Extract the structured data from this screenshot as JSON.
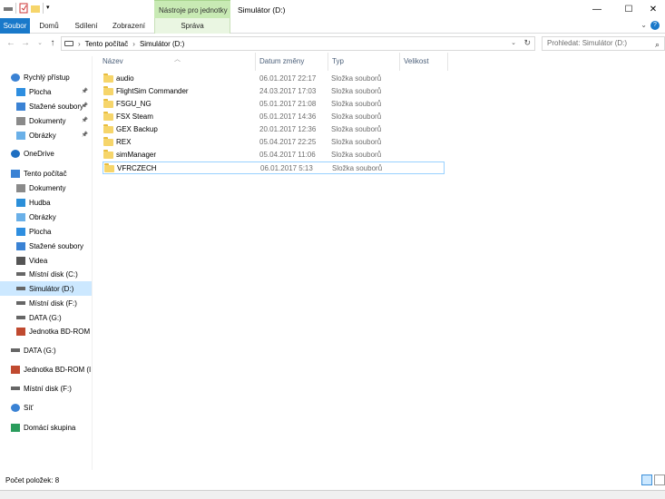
{
  "window": {
    "title": "Simulátor (D:)",
    "context_tab_header": "Nástroje pro jednotky",
    "controls": {
      "minimize": "—",
      "maximize": "☐",
      "close": "✕"
    }
  },
  "ribbon": {
    "tabs": [
      "Soubor",
      "Domů",
      "Sdílení",
      "Zobrazení",
      "Správa"
    ],
    "expand_glyph": "⌄",
    "help_glyph": "?"
  },
  "address": {
    "crumbs": [
      "Tento počítač",
      "Simulátor (D:)"
    ],
    "separator": "›",
    "search_placeholder": "Prohledat: Simulátor (D:)"
  },
  "sidebar": {
    "items": [
      {
        "label": "Rychlý přístup",
        "icon": "star-icon",
        "pinned": false
      },
      {
        "label": "Plocha",
        "icon": "desktop-icon",
        "pinned": true
      },
      {
        "label": "Stažené soubory",
        "icon": "download-icon",
        "pinned": true
      },
      {
        "label": "Dokumenty",
        "icon": "documents-icon",
        "pinned": true
      },
      {
        "label": "Obrázky",
        "icon": "pictures-icon",
        "pinned": true
      },
      {
        "label": "OneDrive",
        "icon": "cloud-icon",
        "pinned": false
      },
      {
        "label": "Tento počítač",
        "icon": "computer-icon",
        "pinned": false
      },
      {
        "label": "Dokumenty",
        "icon": "documents-icon",
        "pinned": false
      },
      {
        "label": "Hudba",
        "icon": "music-icon",
        "pinned": false
      },
      {
        "label": "Obrázky",
        "icon": "pictures-icon",
        "pinned": false
      },
      {
        "label": "Plocha",
        "icon": "desktop-icon",
        "pinned": false
      },
      {
        "label": "Stažené soubory",
        "icon": "download-icon",
        "pinned": false
      },
      {
        "label": "Videa",
        "icon": "video-icon",
        "pinned": false
      },
      {
        "label": "Místní disk (C:)",
        "icon": "drive-icon",
        "pinned": false
      },
      {
        "label": "Simulátor (D:)",
        "icon": "drive-icon",
        "pinned": false,
        "selected": true
      },
      {
        "label": "Místní disk (F:)",
        "icon": "drive-icon",
        "pinned": false
      },
      {
        "label": "DATA (G:)",
        "icon": "drive-icon",
        "pinned": false
      },
      {
        "label": "Jednotka BD-ROM (",
        "icon": "disc-icon",
        "pinned": false
      },
      {
        "label": "DATA (G:)",
        "icon": "drive-icon",
        "pinned": false
      },
      {
        "label": "Jednotka BD-ROM (I:",
        "icon": "disc-icon",
        "pinned": false
      },
      {
        "label": "Místní disk (F:)",
        "icon": "drive-icon",
        "pinned": false
      },
      {
        "label": "Síť",
        "icon": "network-icon",
        "pinned": false
      },
      {
        "label": "Domácí skupina",
        "icon": "homegroup-icon",
        "pinned": false
      }
    ]
  },
  "columns": [
    "Název",
    "Datum změny",
    "Typ",
    "Velikost"
  ],
  "files": [
    {
      "name": "audio",
      "date": "06.01.2017 22:17",
      "type": "Složka souborů"
    },
    {
      "name": "FlightSim Commander",
      "date": "24.03.2017 17:03",
      "type": "Složka souborů"
    },
    {
      "name": "FSGU_NG",
      "date": "05.01.2017 21:08",
      "type": "Složka souborů"
    },
    {
      "name": "FSX Steam",
      "date": "05.01.2017 14:36",
      "type": "Složka souborů"
    },
    {
      "name": "GEX Backup",
      "date": "20.01.2017 12:36",
      "type": "Složka souborů"
    },
    {
      "name": "REX",
      "date": "05.04.2017 22:25",
      "type": "Složka souborů"
    },
    {
      "name": "simManager",
      "date": "05.04.2017 11:06",
      "type": "Složka souborů"
    },
    {
      "name": "VFRCZECH",
      "date": "06.01.2017 5:13",
      "type": "Složka souborů",
      "selected": true
    }
  ],
  "status": {
    "item_count": "Počet položek: 8"
  },
  "colors": {
    "accent": "#1979ca",
    "selection": "#cce8ff",
    "context_tab": "#c8eab4",
    "folder": "#f6d56a"
  }
}
